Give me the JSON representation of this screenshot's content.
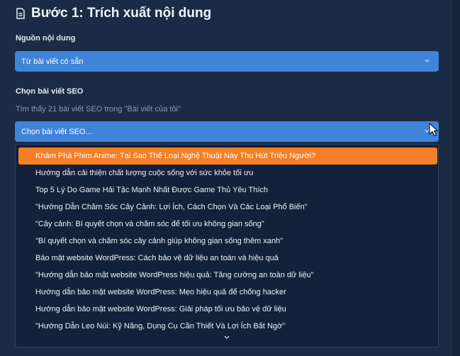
{
  "header": {
    "title": "Bước 1: Trích xuất nội dung",
    "icon": "document-icon"
  },
  "source": {
    "label": "Nguồn nội dung",
    "selected": "Từ bài viết có sẵn"
  },
  "seo": {
    "label": "Chọn bài viết SEO",
    "hint": "Tìm thấy 21 bài viết SEO trong \"Bài viết của tôi\"",
    "placeholder": "Chọn bài viết SEO..."
  },
  "options": [
    "Khám Phá Phim Anime: Tại Sao Thể Loại Nghệ Thuật Này Thu Hút Triệu Người?",
    "Hướng dẫn cải thiện chất lượng cuộc sống với sức khỏe tối ưu",
    "Top 5 Lý Do Game Hải Tặc Mạnh Nhất Được Game Thủ Yêu Thích",
    "\"Hướng Dẫn Chăm Sóc Cây Cảnh: Lợi Ích, Cách Chọn Và Các Loại Phổ Biến\"",
    "\"Cây cảnh: Bí quyết chọn và chăm sóc để tối ưu không gian sống\"",
    "\"Bí quyết chọn và chăm sóc cây cảnh giúp không gian sống thêm xanh\"",
    "Bảo mật website WordPress: Cách bảo vệ dữ liệu an toàn và hiệu quả",
    "\"Hướng dẫn bảo mật website WordPress hiệu quả: Tăng cường an toàn dữ liệu\"",
    "Hướng dẫn bảo mật website WordPress: Mẹo hiệu quả để chống hacker",
    "Hướng dẫn bảo mật website WordPress: Giải pháp tối ưu bảo vệ dữ liệu",
    "\"Hướng Dẫn Leo Núi: Kỹ Năng, Dụng Cụ Cần Thiết Và Lợi Ích Bất Ngờ\""
  ],
  "highlighted_index": 0,
  "colors": {
    "accent": "#3f84d8",
    "highlight": "#f57f24",
    "panel": "#1c2b45"
  }
}
